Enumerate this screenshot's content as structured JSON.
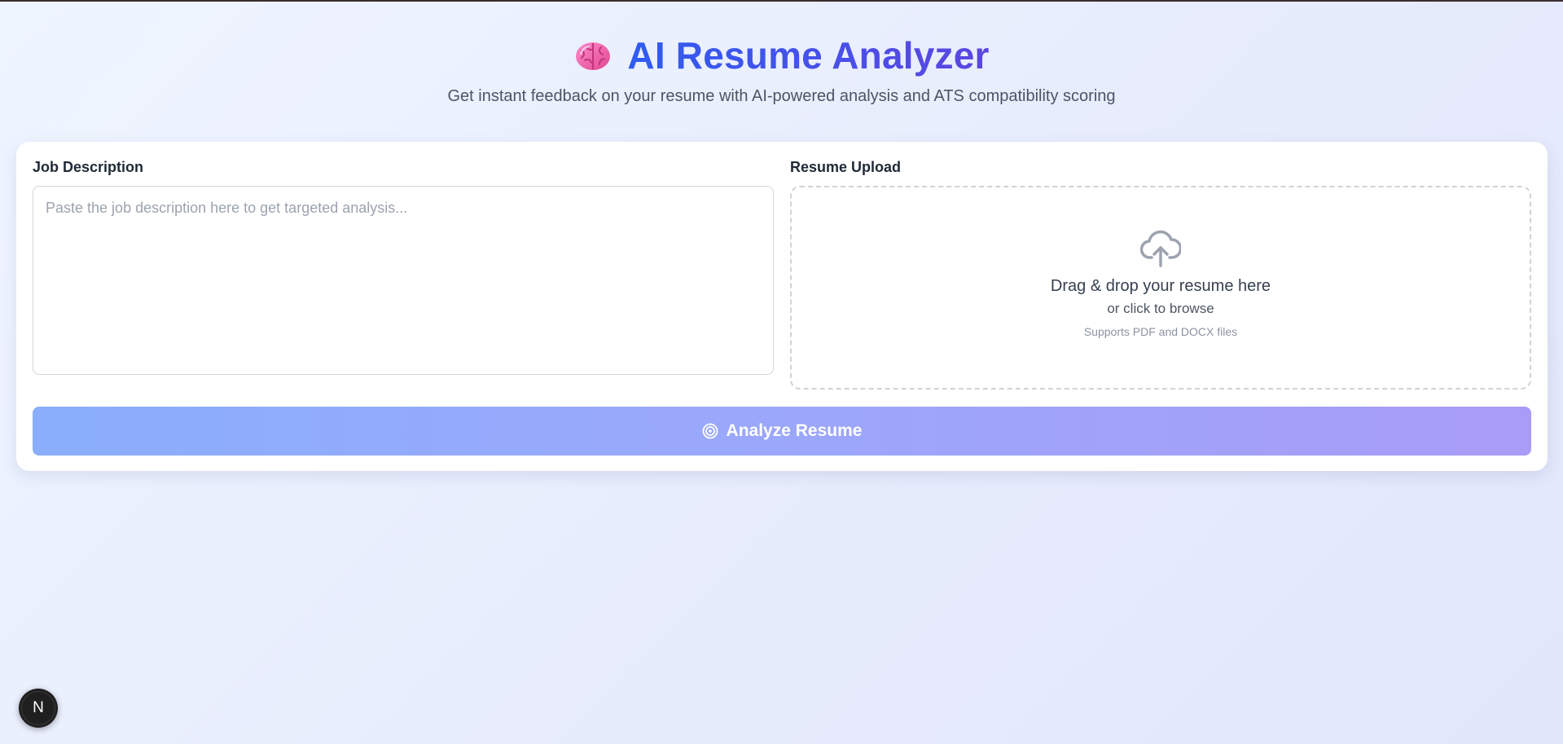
{
  "header": {
    "icon": "brain-icon",
    "title": "AI Resume Analyzer",
    "subtitle": "Get instant feedback on your resume with AI-powered analysis and ATS compatibility scoring"
  },
  "job_description": {
    "label": "Job Description",
    "placeholder": "Paste the job description here to get targeted analysis...",
    "value": ""
  },
  "resume_upload": {
    "label": "Resume Upload",
    "icon": "cloud-upload-icon",
    "title": "Drag & drop your resume here",
    "subtitle": "or click to browse",
    "hint": "Supports PDF and DOCX files"
  },
  "analyze_button": {
    "icon": "target-icon",
    "label": "Analyze Resume"
  },
  "dev_badge": {
    "icon": "nextjs-icon",
    "letter": "N"
  },
  "colors": {
    "title_start": "#2f5cf0",
    "title_end": "#5b45e0",
    "button_start": "#8aaefc",
    "button_end": "#a89cf7",
    "background": "#eff5ff"
  }
}
